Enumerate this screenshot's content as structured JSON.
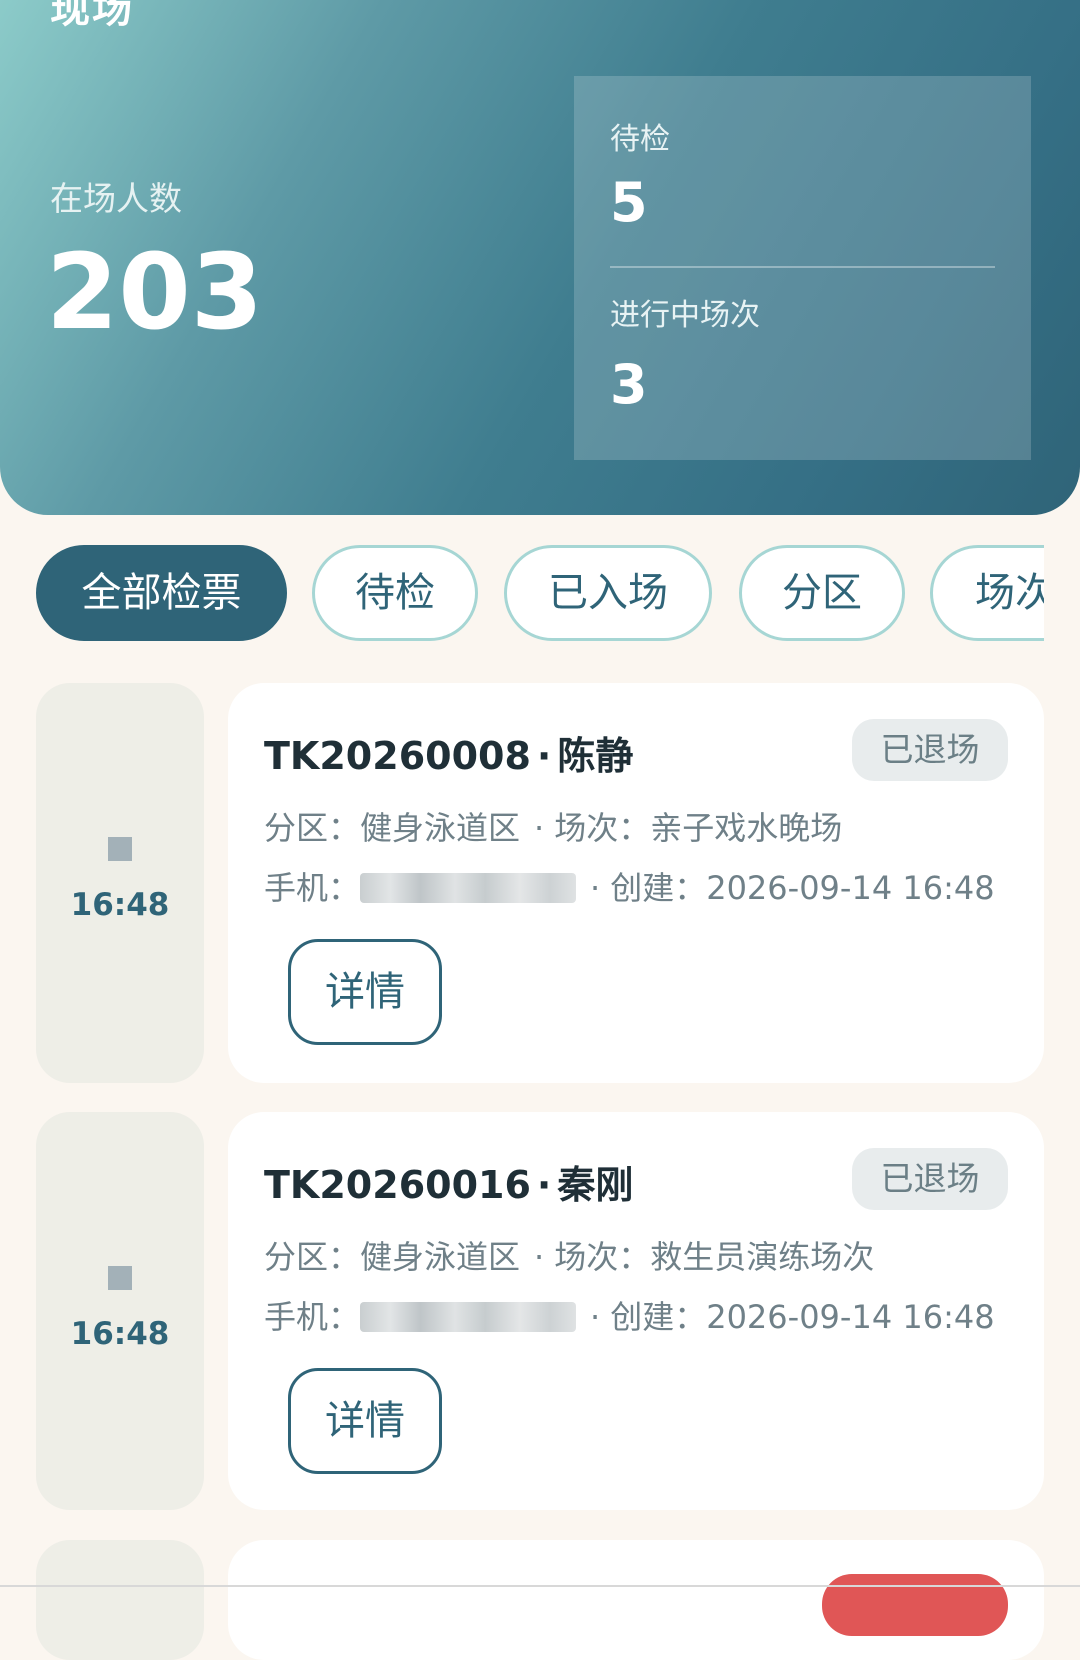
{
  "header": {
    "title": "现场",
    "onsite_label": "在场人数",
    "onsite_value": "203",
    "pending_label": "待检",
    "pending_value": "5",
    "sessions_label": "进行中场次",
    "sessions_value": "3"
  },
  "filters": [
    {
      "label": "全部检票",
      "active": true
    },
    {
      "label": "待检",
      "active": false
    },
    {
      "label": "已入场",
      "active": false
    },
    {
      "label": "分区",
      "active": false
    },
    {
      "label": "场次",
      "active": false
    }
  ],
  "tickets": [
    {
      "time": "16:48",
      "code": "TK20260008",
      "name": "陈静",
      "status": "已退场",
      "zone_label": "分区：",
      "zone": "健身泳道区",
      "session_label": "场次：",
      "session": "亲子戏水晚场",
      "phone_label": "手机：",
      "phone": "1****",
      "created_label": "创建：",
      "created": "2026-09-14 16:48",
      "detail_label": "详情"
    },
    {
      "time": "16:48",
      "code": "TK20260016",
      "name": "秦刚",
      "status": "已退场",
      "zone_label": "分区：",
      "zone": "健身泳道区",
      "session_label": "场次：",
      "session": "救生员演练场次",
      "phone_label": "手机：",
      "phone": "1****",
      "created_label": "创建：",
      "created": "2026-09-14 16:48",
      "detail_label": "详情"
    }
  ],
  "separator": "·",
  "colors": {
    "primary": "#2f6478",
    "chip_border": "#a6d6d4",
    "background": "#fbf6f0",
    "status_bg": "#e8eced",
    "alert": "#e05656"
  }
}
